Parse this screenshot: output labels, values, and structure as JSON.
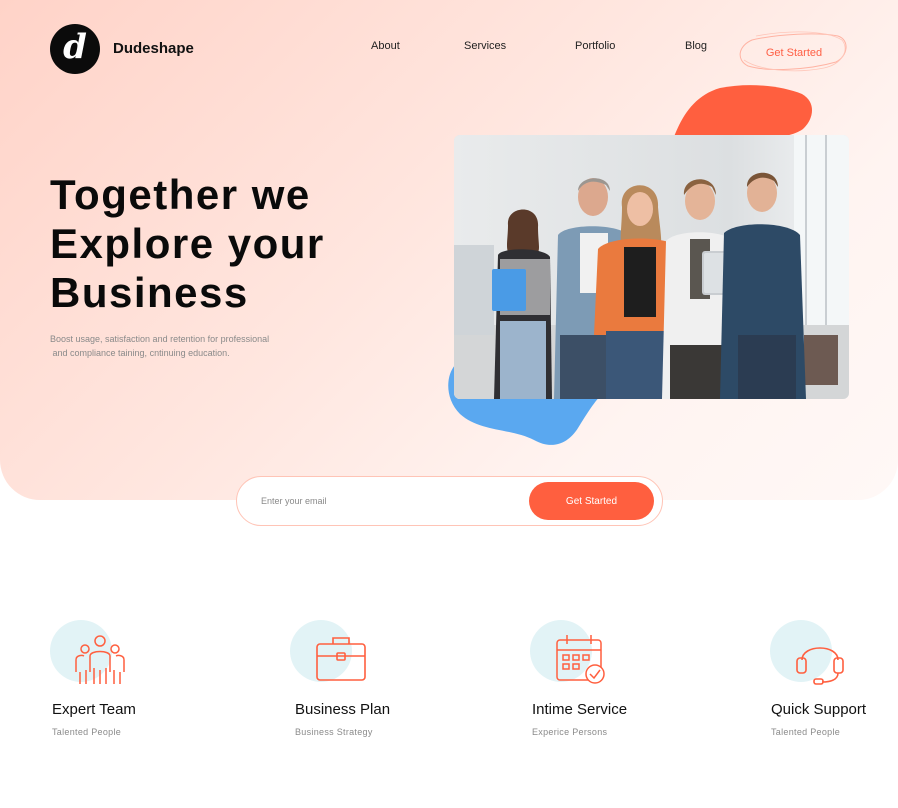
{
  "brand": {
    "logo_letter": "d",
    "name": "Dudeshape"
  },
  "nav": {
    "items": [
      {
        "label": "About"
      },
      {
        "label": "Services"
      },
      {
        "label": "Portfolio"
      },
      {
        "label": "Blog"
      }
    ],
    "cta_label": "Get Started"
  },
  "hero": {
    "title_lines": [
      "Together we",
      "Explore your",
      "Business"
    ],
    "subtitle_lines": [
      "Boost usage, satisfaction and retention for professional",
      " and compliance taining, cntinuing education."
    ],
    "photo_icon": "team-photo"
  },
  "signup": {
    "email_placeholder": "Enter your email",
    "button_label": "Get Started"
  },
  "features": [
    {
      "title": "Expert Team",
      "subtitle": "Talented People",
      "icon": "team-icon"
    },
    {
      "title": "Business Plan",
      "subtitle": "Business Strategy",
      "icon": "briefcase-icon"
    },
    {
      "title": "Intime Service",
      "subtitle": "Experice Persons",
      "icon": "calendar-check-icon"
    },
    {
      "title": "Quick Support",
      "subtitle": "Talented People",
      "icon": "headset-icon"
    }
  ],
  "colors": {
    "accent": "#ff5f3f",
    "hero_bg": "#ffe2da",
    "blob_blue": "#5aa8f0",
    "underline": "#a6c8f0",
    "icon_circle": "#e2f3f6",
    "text_dark": "#0a0a0a",
    "text_muted": "#8a8a8a"
  }
}
